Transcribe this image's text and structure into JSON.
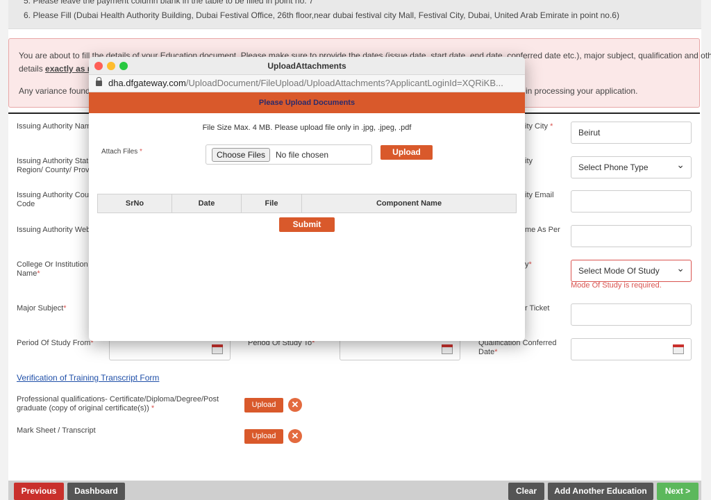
{
  "instructions": {
    "line5": "5. Please leave the payment column blank in the table to be filled in point no. 7",
    "line6": "6. Please Fill (Dubai Health Authority Building, Dubai Festival Office, 26th floor,near dubai festival city Mall, Festival City, Dubai, United Arab Emirate in point no.6)"
  },
  "alert": {
    "line1": "You are about to fill the details of your Education document. Please make sure to provide the dates (issue date, start date, end date, conferred date etc.), major subject, qualification and other",
    "line2_prefix": "details",
    "line2_emph": "exactly as m",
    "line3": "Any variance found",
    "line3_tail": "in processing your application."
  },
  "form": {
    "issuing_authority_name": "Issuing Authority Nam",
    "issuing_authority_state": "Issuing Authority State\nRegion/ County/ Provi",
    "issuing_authority_country_code": "Issuing Authority Coun\nCode",
    "issuing_authority_website": "Issuing Authority Webs",
    "college_label": "College Or Institution\nName",
    "major_subject_label": "Major Subject",
    "period_from_label": "Period Of Study From",
    "period_to_label": "Period Of Study To",
    "qualification_conferred_label": "Qualification Conferred\nDate",
    "city_label": "ity City",
    "city_value": "Beirut",
    "phone_type_label": "ity",
    "phone_type_value": "Select Phone Type",
    "email_label": "ity Email",
    "name_as_per_label": "me As Per",
    "mode_label": "y",
    "mode_value": "Select Mode Of Study",
    "mode_error": "Mode Of Study is required.",
    "ticket_label": "r Ticket",
    "required_mark": "*"
  },
  "verification_link": "Verification of Training Transcript Form",
  "uploads": {
    "professional_label": "Professional qualifications- Certificate/Diploma/Degree/Post\ngraduate (copy of original certificate(s))",
    "marksheet_label": "Mark Sheet / Transcript",
    "upload_label": "Upload",
    "remove_glyph": "✕"
  },
  "footer": {
    "previous": "Previous",
    "dashboard": "Dashboard",
    "clear": "Clear",
    "add_another": "Add Another Education",
    "next": "Next >"
  },
  "modal": {
    "window_title": "UploadAttachments",
    "url_host": "dha.dfgateway.com",
    "url_path": "/UploadDocument/FileUpload/UploadAttachments?ApplicantLoginId=XQRiKB...",
    "header": "Please Upload Documents",
    "note": "File Size Max. 4 MB. Please upload file only in .jpg, .jpeg, .pdf",
    "attach_label": "Attach Files",
    "choose_files": "Choose Files",
    "no_file": "No file chosen",
    "upload_button": "Upload",
    "table_headers": [
      "SrNo",
      "Date",
      "File",
      "Component Name"
    ],
    "submit": "Submit"
  },
  "colors": {
    "accent_orange": "#d9592b",
    "error_red": "#d9534f",
    "previous_btn": "#c9302c",
    "dashboard_btn": "#555555",
    "next_btn": "#5cb85c"
  }
}
